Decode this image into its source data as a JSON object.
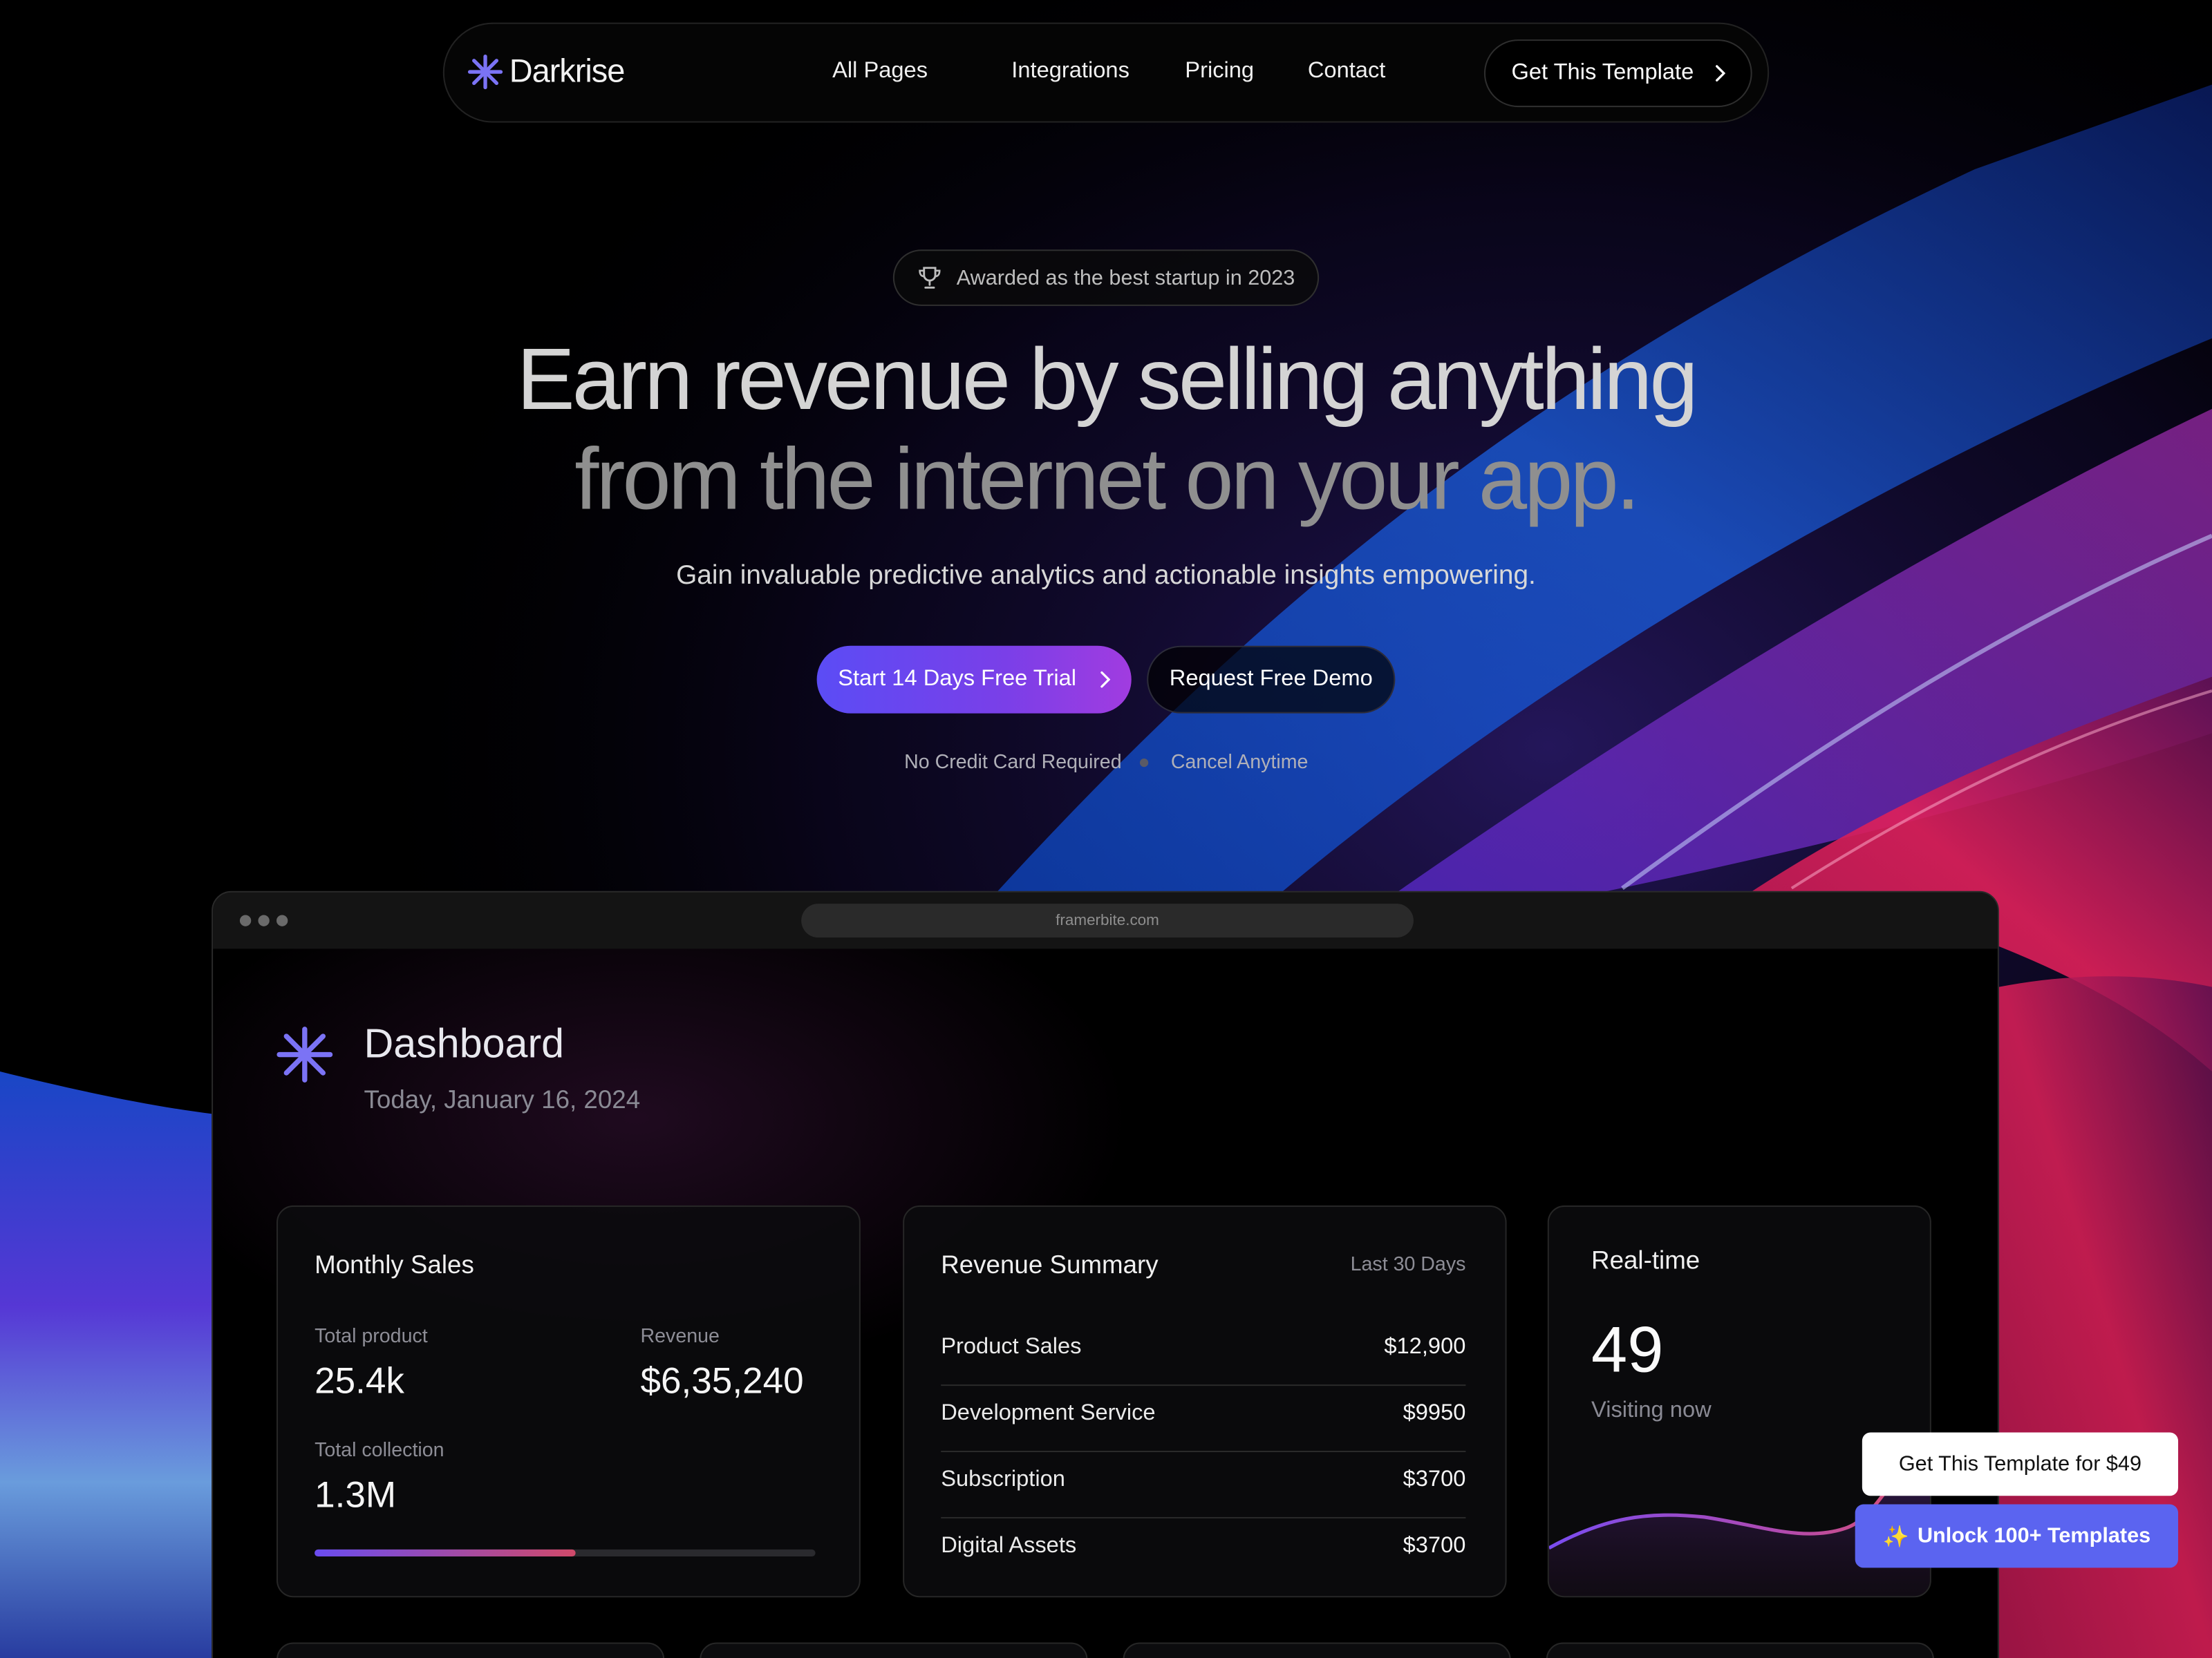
{
  "nav": {
    "logo_text": "Darkrise",
    "links": [
      "All Pages",
      "Integrations",
      "Pricing",
      "Contact"
    ],
    "cta_label": "Get This Template"
  },
  "hero": {
    "award": "Awarded as the best startup in 2023",
    "headline_line1": "Earn revenue by selling anything",
    "headline_line2": "from the internet on your app.",
    "subheadline": "Gain invaluable predictive analytics and actionable insights empowering.",
    "primary_cta": "Start 14 Days Free Trial",
    "secondary_cta": "Request Free Demo",
    "notes": [
      "No Credit Card Required",
      "Cancel Anytime"
    ]
  },
  "browser": {
    "url": "framerbite.com"
  },
  "dashboard": {
    "title": "Dashboard",
    "date": "Today, January 16, 2024",
    "monthly_sales": {
      "title": "Monthly Sales",
      "total_product_label": "Total product",
      "total_product_value": "25.4k",
      "revenue_label": "Revenue",
      "revenue_value": "$6,35,240",
      "total_collection_label": "Total collection",
      "total_collection_value": "1.3M",
      "progress_fraction": 0.52
    },
    "revenue_summary": {
      "title": "Revenue Summary",
      "period": "Last 30 Days",
      "rows": [
        {
          "name": "Product Sales",
          "amount": "$12,900"
        },
        {
          "name": "Development Service",
          "amount": "$9950"
        },
        {
          "name": "Subscription",
          "amount": "$3700"
        },
        {
          "name": "Digital Assets",
          "amount": "$3700"
        }
      ]
    },
    "realtime": {
      "title": "Real-time",
      "value": "49",
      "label": "Visiting now"
    }
  },
  "promos": {
    "buy": "Get This Template for $49",
    "unlock": "Unlock 100+ Templates",
    "unlock_icon": "sparkles-icon"
  },
  "colors": {
    "accent": "#5b4cf5",
    "promo": "#5b64f0",
    "background": "#000000"
  }
}
